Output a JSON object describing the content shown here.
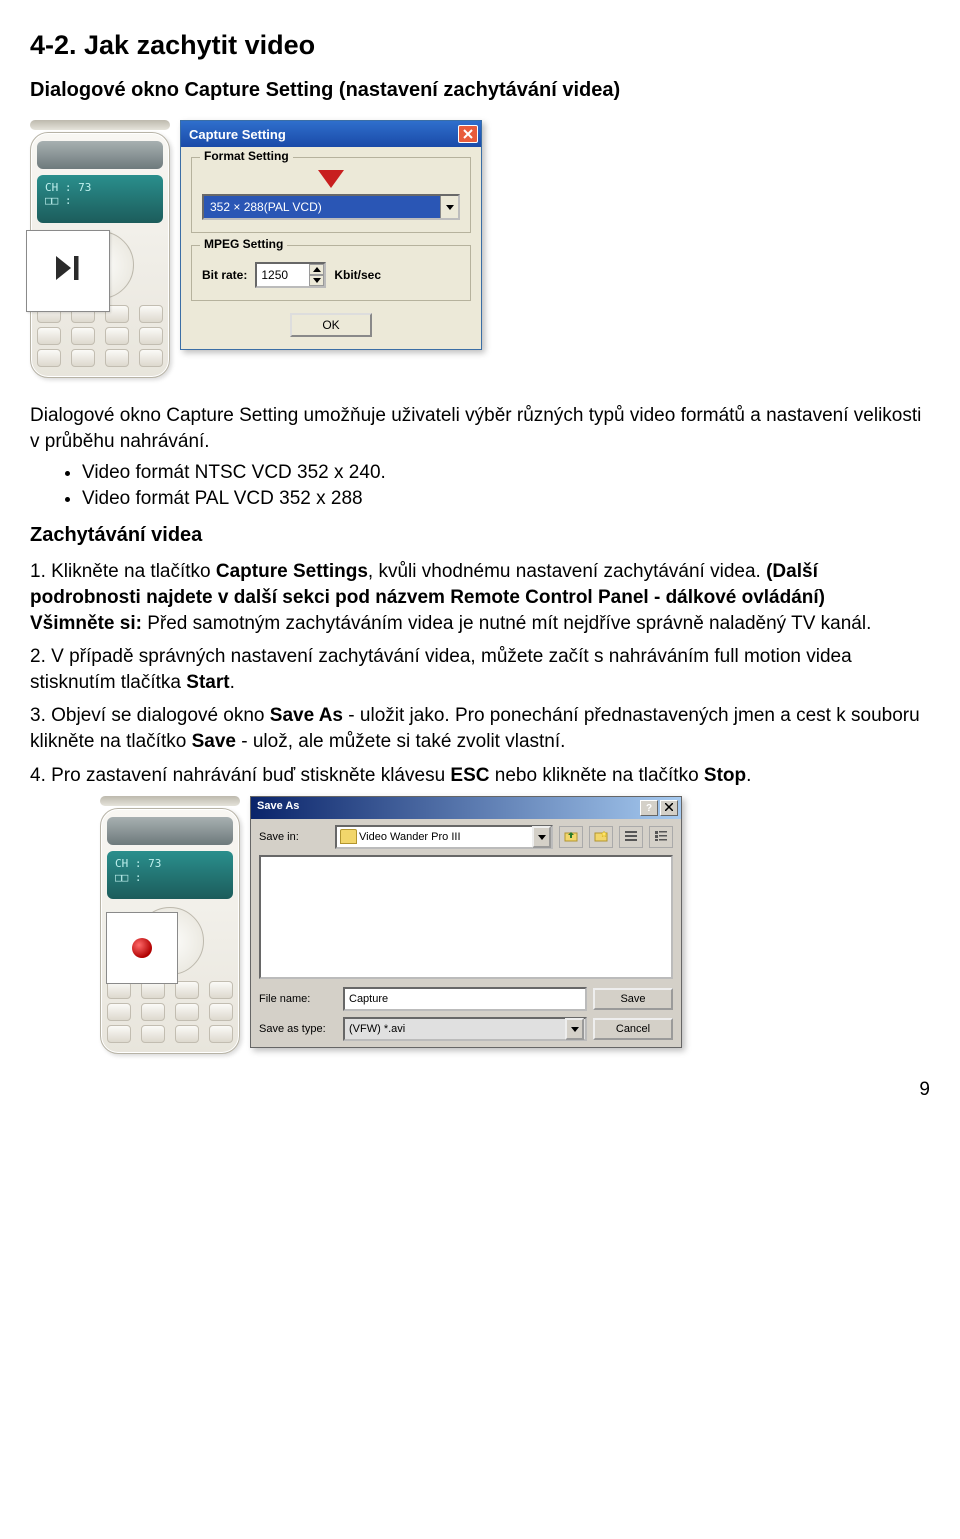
{
  "section_title": "4-2. Jak zachytit video",
  "lead": "Dialogové okno Capture Setting (nastavení zachytávání videa)",
  "remote": {
    "brand": "",
    "lcd_line1": "CH : 73",
    "lcd_line2": "□□ :"
  },
  "capture_dialog": {
    "title": "Capture Setting",
    "group_format": "Format Setting",
    "format_value": "352 × 288(PAL VCD)",
    "group_mpeg": "MPEG Setting",
    "bitrate_label": "Bit rate:",
    "bitrate_value": "1250",
    "bitrate_unit": "Kbit/sec",
    "ok": "OK"
  },
  "para_intro": "Dialogové okno Capture Setting umožňuje uživateli výběr různých typů video formátů a nastavení velikosti v průběhu nahrávání.",
  "bullets": [
    "Video formát NTSC VCD 352 x 240.",
    "Video formát PAL VCD 352 x 288"
  ],
  "subhead": "Zachytávání videa",
  "steps": {
    "s1a": "1. Klikněte na tlačítko ",
    "s1b": "Capture Settings",
    "s1c": ", kvůli vhodnému nastavení zachytávání videa. ",
    "s1d": "(Další podrobnosti najdete v další sekci pod názvem Remote Control Panel - dálkové ovládání)",
    "s1e_label": "Všimněte si:",
    "s1e": " Před samotným zachytáváním videa je nutné mít nejdříve správně naladěný TV kanál.",
    "s2a": "2. V případě správných nastavení zachytávání videa, můžete začít s nahráváním full motion videa stisknutím tlačítka ",
    "s2b": "Start",
    "s2c": ".",
    "s3a": "3. Objeví se dialogové okno ",
    "s3b": "Save As",
    "s3c": " - uložit jako. Pro ponechání přednastavených jmen a cest k souboru klikněte na tlačítko ",
    "s3d": "Save",
    "s3e": " - ulož, ale můžete si také zvolit vlastní.",
    "s4a": "4. Pro zastavení nahrávání buď stiskněte klávesu ",
    "s4b": "ESC",
    "s4c": " nebo klikněte na tlačítko ",
    "s4d": "Stop",
    "s4e": "."
  },
  "save_dialog": {
    "title": "Save As",
    "savein_label": "Save in:",
    "savein_value": "Video Wander Pro III",
    "filename_label": "File name:",
    "filename_value": "Capture",
    "type_label": "Save as type:",
    "type_value": "(VFW) *.avi",
    "save": "Save",
    "cancel": "Cancel"
  },
  "page_number": "9"
}
